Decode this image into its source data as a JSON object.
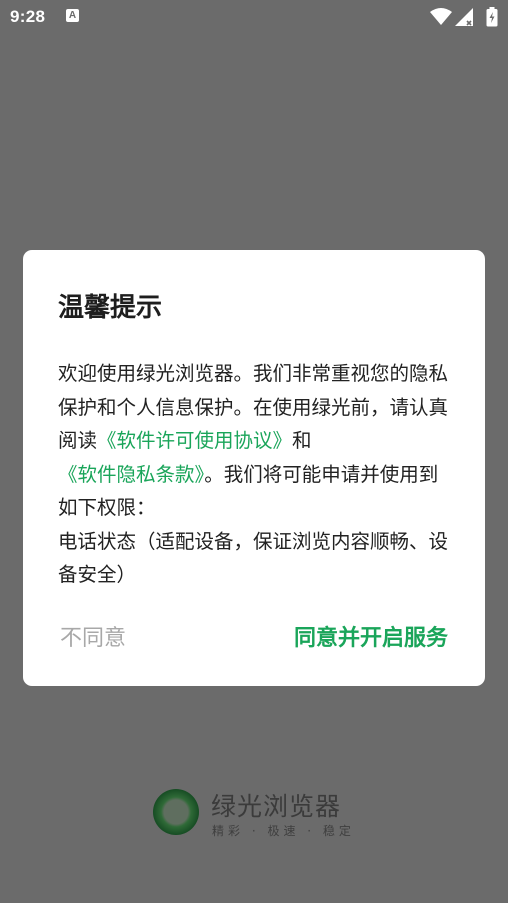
{
  "status_bar": {
    "time": "9:28",
    "notification_icon_label": "A",
    "icons": [
      "wifi-icon",
      "signal-icon",
      "battery-icon"
    ]
  },
  "splash": {
    "app_name": "绿光浏览器",
    "slogan": "精彩 · 极速 · 稳定"
  },
  "dialog": {
    "title": "温馨提示",
    "body": {
      "p1": "欢迎使用绿光浏览器。我们非常重视您的隐私保护和个人信息保护。在使用绿光前，请认真阅读",
      "link_license": "《软件许可使用协议》",
      "p2": "和",
      "link_privacy": "《软件隐私条款》",
      "p3": "。我们将可能申请并使用到如下权限：",
      "permission": "电话状态（适配设备，保证浏览内容顺畅、设备安全）"
    },
    "decline_label": "不同意",
    "accept_label": "同意并开启服务"
  },
  "colors": {
    "accent": "#1aa55a",
    "scrim": "#6b6b6b",
    "decline_text": "#a8a8a8"
  }
}
